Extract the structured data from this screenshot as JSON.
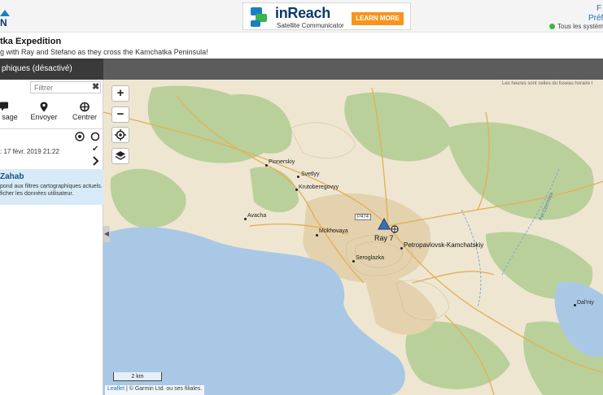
{
  "header": {
    "ad": {
      "title": "inReach",
      "subtitle": "Satellite Communicator",
      "button": "LEARN MORE"
    },
    "link1": "F",
    "link2": "Préf",
    "status": "Tous les systèm"
  },
  "page": {
    "title": "tka Expedition",
    "subtitle": "g with Ray and Stefano as they cross the Kamchatka Peninsula!"
  },
  "panel": {
    "head": "phiques (désactivé)",
    "filter_placeholder": "Filtrer",
    "actions": [
      {
        "label": "sage",
        "icon": "message-icon"
      },
      {
        "label": "Envoyer",
        "icon": "location-pin-icon"
      },
      {
        "label": "Centrer",
        "icon": "crosshair-icon"
      }
    ],
    "timestamp": ": 17 févr. 2019 21:22",
    "info": {
      "title": "Zahab",
      "line1": "pond aux filtres cartographiques actuels.",
      "line2": "ficher les données utilisateur."
    }
  },
  "map": {
    "timezone_note": "Les heures sont celles du fuseau horaire l",
    "zoom_in": "+",
    "zoom_out": "−",
    "places": {
      "pionerskiy": "Pionerskiy",
      "svetlyy": "Svetlyy",
      "krutoberegovyy": "Krutoberegovyy",
      "avacha": "Avacha",
      "mokhovaya": "Mokhovaya",
      "petropavlovsk": "Petropavlovsk-Kamchatskiy",
      "seroglazka": "Seroglazka",
      "dalniy": "Dal'niy"
    },
    "road": "P474",
    "river": "Pet Ozernaya",
    "device_label": "Ray 7",
    "scale": "2 km",
    "attribution_link": "Leaflet",
    "attribution_text": " | © Garmin Ltd. ou ses filiales."
  },
  "colors": {
    "land": "#efe6d2",
    "forest": "#b9d09a",
    "water": "#a9c8e6",
    "urban": "#e3d2ad",
    "road": "#e0b25a",
    "accent": "#2b6cb0"
  }
}
